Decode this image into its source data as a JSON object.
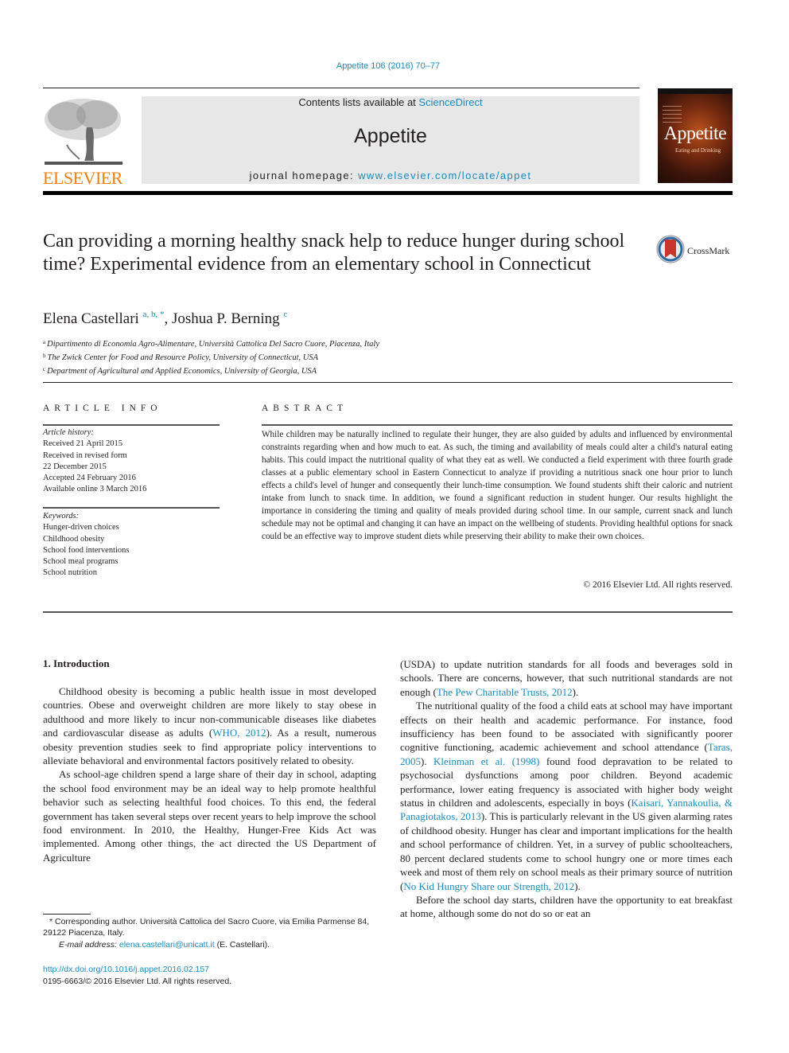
{
  "header": {
    "journal_ref": "Appetite 106 (2016) 70–77",
    "contents_prefix": "Contents lists available at ",
    "contents_link": "ScienceDirect",
    "journal_name": "Appetite",
    "homepage_prefix": "journal homepage: ",
    "homepage_link": "www.elsevier.com/locate/appet",
    "publisher_logo": "ELSEVIER",
    "cover": {
      "title": "Appetite",
      "subtitle": "Eating and Drinking"
    },
    "colors": {
      "link": "#1a8bbd",
      "elsevier": "#f07f0d",
      "banner_bg": "#e7e7e7"
    }
  },
  "article": {
    "title": "Can providing a morning healthy snack help to reduce hunger during school time? Experimental evidence from an elementary school in Connecticut",
    "crossmark_label": "CrossMark",
    "authors": [
      {
        "name": "Elena Castellari",
        "marks": "a, b, *"
      },
      {
        "name": "Joshua P. Berning",
        "marks": "c"
      }
    ],
    "author_separator": ", ",
    "affiliations": [
      {
        "mark": "a",
        "text": "Dipartimento di Economia Agro-Alimentare, Università Cattolica Del Sacro Cuore, Piacenza, Italy"
      },
      {
        "mark": "b",
        "text": "The Zwick Center for Food and Resource Policy, University of Connecticut, USA"
      },
      {
        "mark": "c",
        "text": "Department of Agricultural and Applied Economics, University of Georgia, USA"
      }
    ]
  },
  "article_info": {
    "heading": "ARTICLE INFO",
    "history_label": "Article history:",
    "history": [
      "Received 21 April 2015",
      "Received in revised form",
      "22 December 2015",
      "Accepted 24 February 2016",
      "Available online 3 March 2016"
    ],
    "keywords_label": "Keywords:",
    "keywords": [
      "Hunger-driven choices",
      "Childhood obesity",
      "School food interventions",
      "School meal programs",
      "School nutrition"
    ]
  },
  "abstract": {
    "heading": "ABSTRACT",
    "text": "While children may be naturally inclined to regulate their hunger, they are also guided by adults and influenced by environmental constraints regarding when and how much to eat. As such, the timing and availability of meals could alter a child's natural eating habits. This could impact the nutritional quality of what they eat as well. We conducted a field experiment with three fourth grade classes at a public elementary school in Eastern Connecticut to analyze if providing a nutritious snack one hour prior to lunch effects a child's level of hunger and consequently their lunch-time consumption. We found students shift their caloric and nutrient intake from lunch to snack time. In addition, we found a significant reduction in student hunger. Our results highlight the importance in considering the timing and quality of meals provided during school time. In our sample, current snack and lunch schedule may not be optimal and changing it can have an impact on the wellbeing of students. Providing healthful options for snack could be an effective way to improve student diets while preserving their ability to make their own choices.",
    "copyright": "© 2016 Elsevier Ltd. All rights reserved."
  },
  "body": {
    "section_heading": "1.  Introduction",
    "left": {
      "p1_a": "Childhood obesity is becoming a public health issue in most developed countries. Obese and overweight children are more likely to stay obese in adulthood and more likely to incur non-communicable diseases like diabetes and cardiovascular disease as adults (",
      "p1_link": "WHO, 2012",
      "p1_b": "). As a result, numerous obesity prevention studies seek to find appropriate policy interventions to alleviate behavioral and environmental factors positively related to obesity.",
      "p2": "As school-age children spend a large share of their day in school, adapting the school food environment may be an ideal way to help promote healthful behavior such as selecting healthful food choices. To this end, the federal government has taken several steps over recent years to help improve the school food environment. In 2010, the Healthy, Hunger-Free Kids Act was implemented. Among other things, the act directed the US Department of Agriculture"
    },
    "right": {
      "p1_a": "(USDA) to update nutrition standards for all foods and beverages sold in schools. There are concerns, however, that such nutritional standards are not enough (",
      "p1_link": "The Pew Charitable Trusts, 2012",
      "p1_b": ").",
      "p2_a": "The nutritional quality of the food a child eats at school may have important effects on their health and academic performance. For instance, food insufficiency has been found to be associated with significantly poorer cognitive functioning, academic achievement and school attendance (",
      "p2_link1": "Taras, 2005",
      "p2_b": "). ",
      "p2_link2": "Kleinman et al. (1998)",
      "p2_c": " found food depravation to be related to psychosocial dysfunctions among poor children. Beyond academic performance, lower eating frequency is associated with higher body weight status in children and adolescents, especially in boys (",
      "p2_link3": "Kaisari, Yannakoulia, & Panagiotakos, 2013",
      "p2_d": "). This is particularly relevant in the US given alarming rates of childhood obesity. Hunger has clear and important implications for the health and school performance of children. Yet, in a survey of public schoolteachers, 80 percent declared students come to school hungry one or more times each week and most of them rely on school meals as their primary source of nutrition (",
      "p2_link4": "No Kid Hungry Share our Strength, 2012",
      "p2_e": ").",
      "p3": "Before the school day starts, children have the opportunity to eat breakfast at home, although some do not do so or eat an"
    }
  },
  "footnote": {
    "corresponding": "* Corresponding author. Università Cattolica del Sacro Cuore, via Emilia Parmense 84, 29122 Piacenza, Italy.",
    "email_label": "E-mail address: ",
    "email": "elena.castellari@unicatt.it",
    "email_suffix": " (E. Castellari).",
    "doi": "http://dx.doi.org/10.1016/j.appet.2016.02.157",
    "issn": "0195-6663/© 2016 Elsevier Ltd. All rights reserved."
  }
}
